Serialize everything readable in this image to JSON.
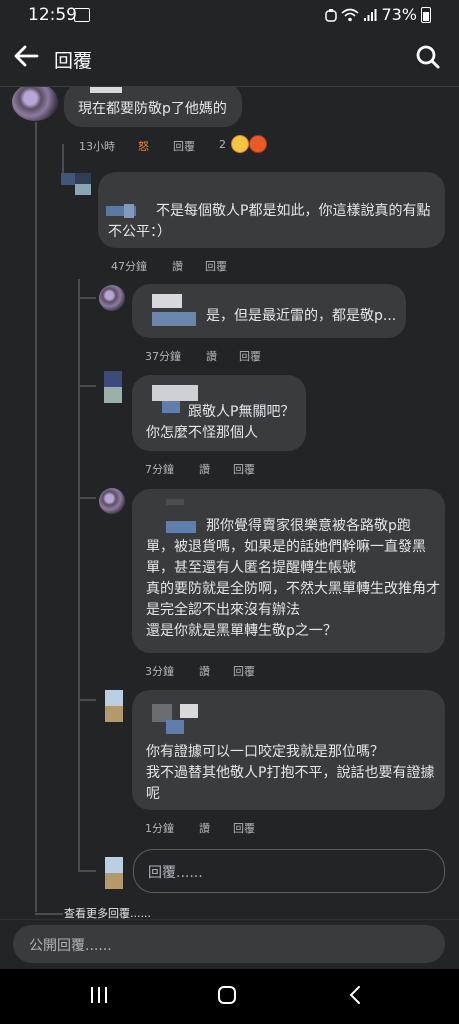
{
  "status_bar": {
    "time": "12:59",
    "battery": "73%"
  },
  "header": {
    "title": "回覆"
  },
  "comments": [
    {
      "text": "現在都要防敬p了他媽的",
      "time": "13小時",
      "actions": [
        "怒",
        "回覆"
      ],
      "reaction_count": "2"
    },
    {
      "text": "不是每個敬人P都是如此，你這樣說真的有點\n不公平：）",
      "time": "47分鐘",
      "actions": [
        "讚",
        "回覆"
      ]
    },
    {
      "text": "是，但是最近雷的，都是敬p...",
      "time": "37分鐘",
      "actions": [
        "讚",
        "回覆"
      ]
    },
    {
      "text": "跟敬人P無關吧？\n你怎麼不怪那個人",
      "time": "7分鐘",
      "actions": [
        "讚",
        "回覆"
      ]
    },
    {
      "text": "那你覺得賣家很樂意被各路敬p跑\n單，被退貨嗎，如果是的話她們幹嘛一直發黑\n單，甚至還有人匿名提醒轉生帳號\n真的要防就是全防啊，不然大黑單轉生改推角才\n是完全認不出來沒有辦法\n還是你就是黑單轉生敬p之一？",
      "time": "3分鐘",
      "actions": [
        "讚",
        "回覆"
      ]
    },
    {
      "text": "你有證據可以一口咬定我就是那位嗎？\n我不過替其他敬人P打抱不平，說話也要有證據\n呢",
      "time": "1分鐘",
      "actions": [
        "讚",
        "回覆"
      ]
    }
  ],
  "reply_box": {
    "placeholder": "回覆......"
  },
  "view_more": "查看更多回覆......",
  "composer": {
    "placeholder": "公開回覆......"
  },
  "colors": {
    "background": "#232426",
    "bubble": "#3a3b3c",
    "angry": "#e5883d"
  }
}
